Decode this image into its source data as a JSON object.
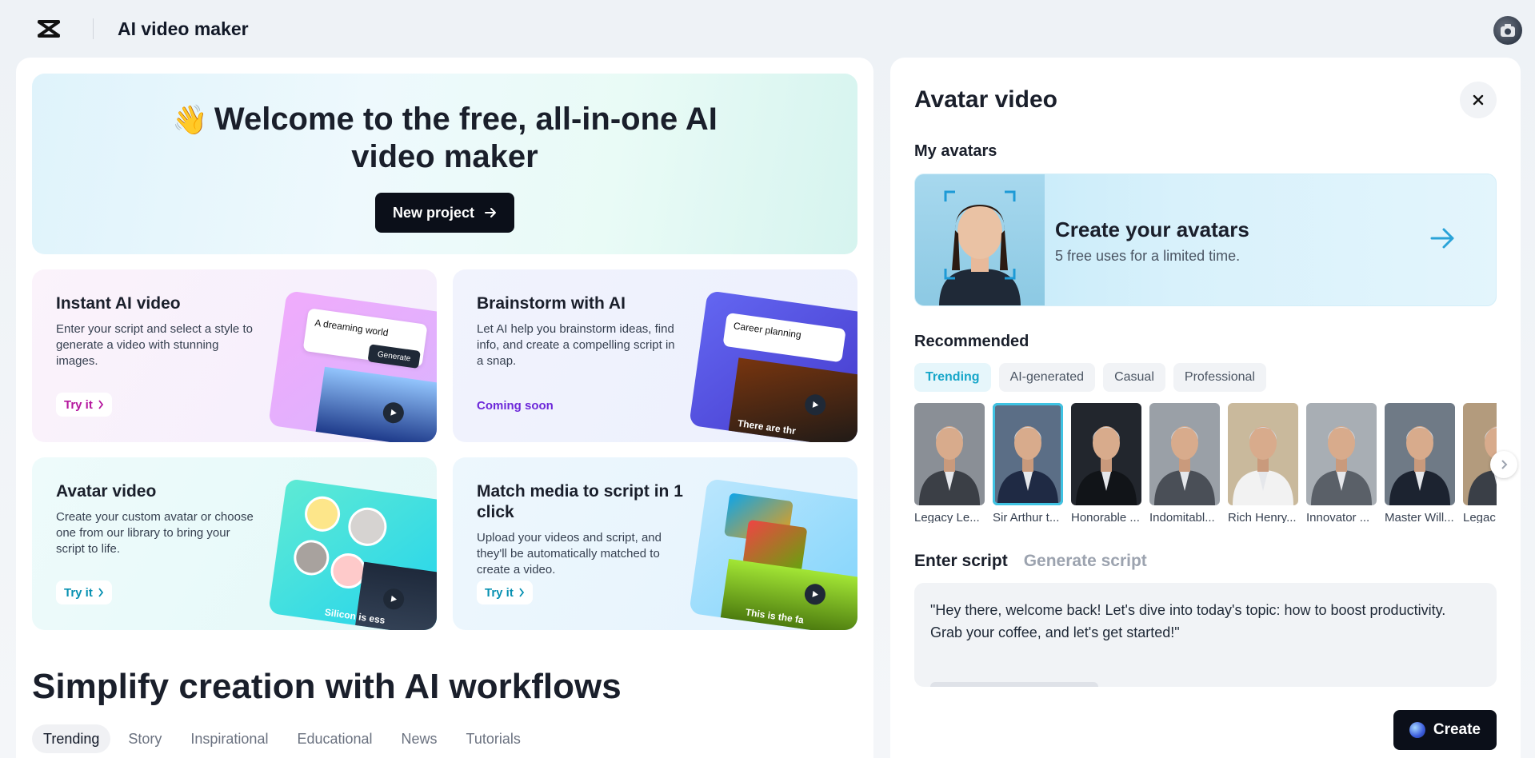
{
  "header": {
    "app_title": "AI video maker"
  },
  "hero": {
    "wave": "👋",
    "title": "Welcome to the free, all-in-one AI video maker",
    "new_project_label": "New project"
  },
  "cards": [
    {
      "title": "Instant AI video",
      "description": "Enter your script and select a style to generate a video with stunning images.",
      "action": "Try it",
      "action_color": "#b5179e",
      "illus_prompt": "A dreaming world",
      "illus_button": "Generate"
    },
    {
      "title": "Brainstorm with AI",
      "description": "Let AI help you brainstorm ideas, find info, and create a compelling script in a snap.",
      "action": "Coming soon",
      "illus_prompt": "Career planning",
      "illus_caption": "There are thr"
    },
    {
      "title": "Avatar video",
      "description": "Create your custom avatar or choose one from our library to bring your script to life.",
      "action": "Try it",
      "action_color": "#0891b2",
      "illus_caption": "Silicon is ess"
    },
    {
      "title": "Match media to script in 1 click",
      "description": "Upload your videos and script, and they'll be automatically matched to create a video.",
      "action": "Try it",
      "action_color": "#0891b2",
      "illus_caption": "This is the fa"
    }
  ],
  "workflows": {
    "title": "Simplify creation with AI workflows",
    "tabs": [
      "Trending",
      "Story",
      "Inspirational",
      "Educational",
      "News",
      "Tutorials"
    ],
    "active_tab": "Trending"
  },
  "avatar_panel": {
    "title": "Avatar video",
    "my_avatars_label": "My avatars",
    "create_title": "Create your avatars",
    "create_subtitle": "5 free uses for a limited time.",
    "recommended_label": "Recommended",
    "chips": [
      "Trending",
      "AI-generated",
      "Casual",
      "Professional"
    ],
    "avatars": [
      {
        "name": "Legacy Le...",
        "bg": "#8a8f96",
        "suit": "#3b3f46"
      },
      {
        "name": "Sir Arthur t...",
        "bg": "#5b6e86",
        "suit": "#1f2a44",
        "selected": true
      },
      {
        "name": "Honorable ...",
        "bg": "#22262d",
        "suit": "#111418"
      },
      {
        "name": "Indomitabl...",
        "bg": "#9aa0a7",
        "suit": "#4a4f57"
      },
      {
        "name": "Rich Henry...",
        "bg": "#c9b99c",
        "suit": "#f2f2f2"
      },
      {
        "name": "Innovator ...",
        "bg": "#a8aeb4",
        "suit": "#5a6068"
      },
      {
        "name": "Master Will...",
        "bg": "#6f7a86",
        "suit": "#1c2330"
      },
      {
        "name": "Legac",
        "bg": "#b39b7d",
        "suit": "#3a3f47"
      }
    ],
    "script_tab_active": "Enter script",
    "script_tab_other": "Generate script",
    "script_text": "\"Hey there, welcome back! Let's dive into today's topic: how to boost productivity. Grab your coffee, and let's get started!\"",
    "create_label": "Create"
  }
}
